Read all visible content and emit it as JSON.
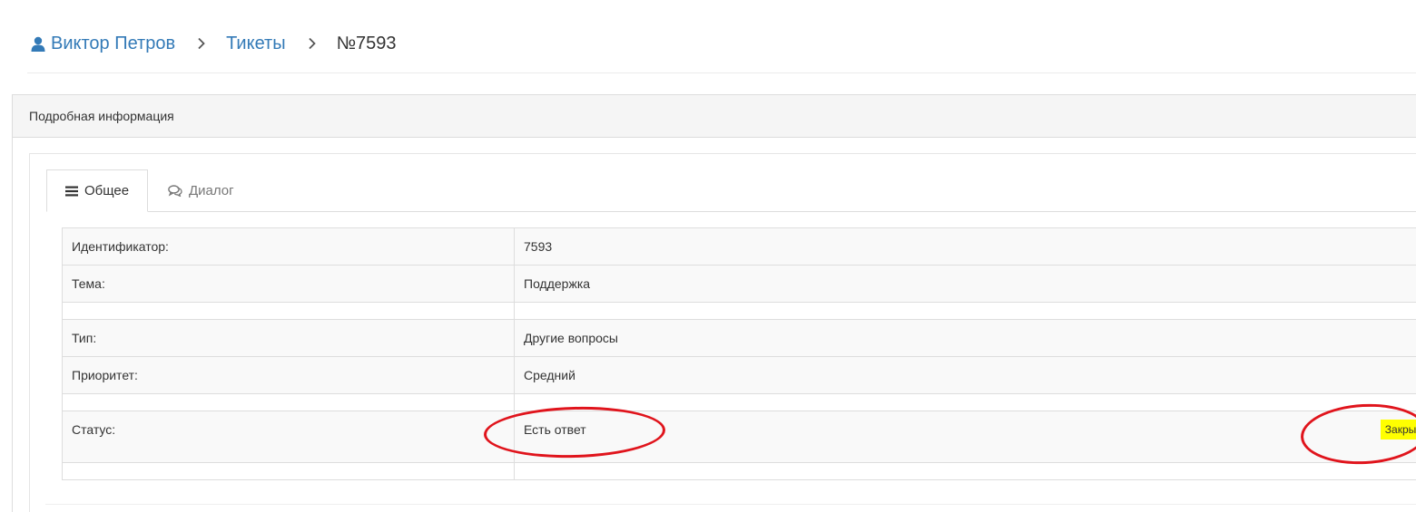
{
  "breadcrumb": {
    "user_icon": "user-icon",
    "user": "Виктор Петров",
    "separator_icon": "chevron-right-icon",
    "section": "Тикеты",
    "current": "№7593"
  },
  "panel": {
    "heading": "Подробная информация"
  },
  "tabs": [
    {
      "label": "Общее",
      "icon": "list-icon",
      "active": true
    },
    {
      "label": "Диалог",
      "icon": "comments-icon",
      "active": false
    }
  ],
  "ticket": {
    "rows": [
      {
        "label": "Идентификатор:",
        "value": "7593"
      },
      {
        "label": "Тема:",
        "value": "Поддержка"
      },
      {
        "label": "Тип:",
        "value": "Другие вопросы"
      },
      {
        "label": "Приоритет:",
        "value": "Средний"
      }
    ],
    "status": {
      "label": "Статус:",
      "value": "Есть ответ"
    },
    "close_button": "Закрыть"
  },
  "colors": {
    "link": "#337ab7",
    "close_button_bg": "#ffff00",
    "annotation": "#e0141c"
  }
}
